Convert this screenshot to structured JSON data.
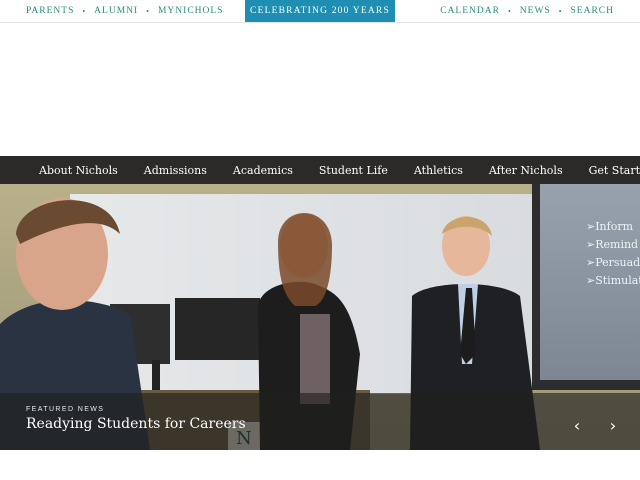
{
  "utility_nav": {
    "left": [
      "PARENTS",
      "ALUMNI",
      "MYNICHOLS"
    ],
    "center": "CELEBRATING 200 YEARS",
    "right": [
      "CALENDAR",
      "NEWS",
      "SEARCH"
    ]
  },
  "main_nav": [
    "About Nichols",
    "Admissions",
    "Academics",
    "Student Life",
    "Athletics",
    "After Nichols",
    "Get Started"
  ],
  "hero": {
    "screen_bullets": [
      "Inform",
      "Remind",
      "Persuade",
      "Stimulate"
    ],
    "podium_letter": "N",
    "featured_label": "FEATURED NEWS",
    "headline": "Readying Students for Careers",
    "prev_icon": "chevron-left-icon",
    "next_icon": "chevron-right-icon"
  },
  "colors": {
    "accent_teal": "#2a8c7a",
    "banner_blue": "#1e8fb3",
    "nav_bg": "#2b2a28"
  }
}
